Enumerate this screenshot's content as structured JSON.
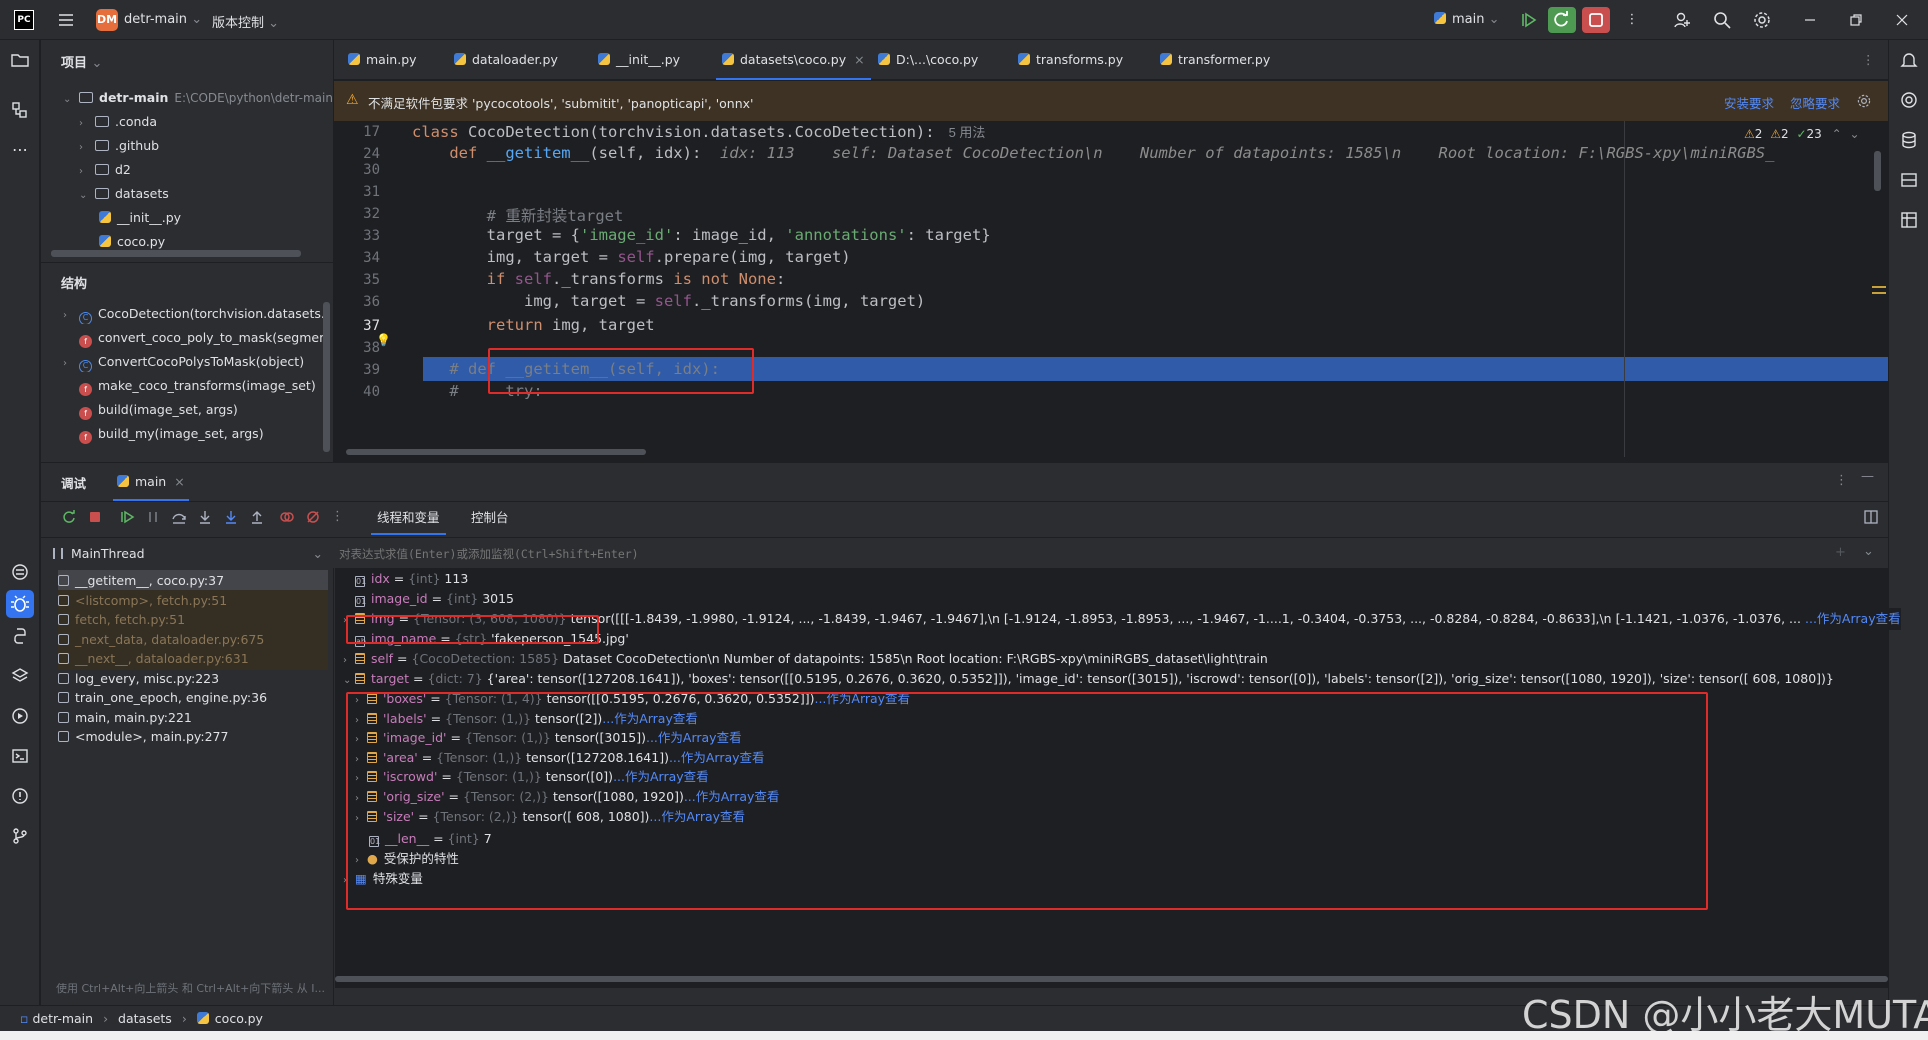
{
  "titlebar": {
    "logo": "PC",
    "project_badge": "DM",
    "project_name": "detr-main",
    "vcs_label": "版本控制",
    "run_config": "main"
  },
  "project_panel": {
    "title": "项目",
    "root_name": "detr-main",
    "root_path": "E:\\CODE\\python\\detr-main",
    "items": [
      ".conda",
      ".github",
      "d2",
      "datasets",
      "__init__.py",
      "coco.py"
    ]
  },
  "structure_panel": {
    "title": "结构",
    "items": [
      "CocoDetection(torchvision.datasets.CocoDetection)",
      "convert_coco_poly_to_mask(segmentations, height, width)",
      "ConvertCocoPolysToMask(object)",
      "make_coco_transforms(image_set)",
      "build(image_set, args)",
      "build_my(image_set, args)"
    ]
  },
  "tabs": [
    "main.py",
    "dataloader.py",
    "__init__.py",
    "datasets\\coco.py",
    "D:\\...\\coco.py",
    "transforms.py",
    "transformer.py"
  ],
  "warning": {
    "text": "不满足软件包要求 'pycocotools', 'submitit', 'panopticapi', 'onnx'",
    "install": "安装要求",
    "ignore": "忽略要求"
  },
  "inspections": {
    "warnings": "2",
    "weak": "2",
    "ok": "23"
  },
  "editor": {
    "lines": [
      {
        "num": "17",
        "parts": [
          [
            "kw",
            "class "
          ],
          [
            "",
            "CocoDetection(torchvision.datasets.CocoDetection):"
          ]
        ],
        "hint": "5 用法"
      },
      {
        "num": "24",
        "parts": [
          [
            "",
            "    "
          ],
          [
            "kw",
            "def "
          ],
          [
            "fn",
            "__getitem__"
          ],
          [
            "",
            "(self, idx):"
          ]
        ],
        "inlay": "  idx: 113    self: Dataset CocoDetection\\n    Number of datapoints: 1585\\n    Root location: F:\\RGBS-xpy\\miniRGBS_"
      },
      {
        "num": "30",
        "parts": []
      },
      {
        "num": "31",
        "parts": []
      },
      {
        "num": "32",
        "parts": [
          [
            "cm",
            "        # 重新封装target"
          ]
        ]
      },
      {
        "num": "33",
        "parts": [
          [
            "",
            "        target = {"
          ],
          [
            "str",
            "'image_id'"
          ],
          [
            "",
            ": image_id, "
          ],
          [
            "str",
            "'annotations'"
          ],
          [
            "",
            ": target}"
          ]
        ]
      },
      {
        "num": "34",
        "parts": [
          [
            "",
            "        img, target = "
          ],
          [
            "self",
            "self"
          ],
          [
            "",
            ".prepare(img, target)"
          ]
        ]
      },
      {
        "num": "35",
        "parts": [
          [
            "",
            "        "
          ],
          [
            "kw",
            "if "
          ],
          [
            "self",
            "self"
          ],
          [
            "",
            "._transforms "
          ],
          [
            "kw",
            "is not None"
          ],
          [
            "",
            ":"
          ]
        ]
      },
      {
        "num": "36",
        "parts": [
          [
            "",
            "            img, target = "
          ],
          [
            "self",
            "self"
          ],
          [
            "",
            "._transforms(img, target)"
          ]
        ]
      },
      {
        "num": "37",
        "parts": [
          [
            "",
            "        "
          ],
          [
            "kw",
            "return "
          ],
          [
            "",
            "img, target"
          ]
        ]
      },
      {
        "num": "38",
        "parts": []
      },
      {
        "num": "39",
        "parts": [
          [
            "cm",
            "    # def __getitem__(self, idx):"
          ]
        ]
      },
      {
        "num": "40",
        "parts": [
          [
            "cm",
            "    #     try:"
          ]
        ]
      }
    ]
  },
  "debug": {
    "tab_debug": "调试",
    "tab_main": "main",
    "tab_threads": "线程和变量",
    "tab_console": "控制台",
    "thread": "MainThread",
    "eval_placeholder": "对表达式求值(Enter)或添加监视(Ctrl+Shift+Enter)",
    "frames": [
      {
        "text": "__getitem__, coco.py:37",
        "kind": "sel"
      },
      {
        "text": "<listcomp>, fetch.py:51",
        "kind": "lib"
      },
      {
        "text": "fetch, fetch.py:51",
        "kind": "lib"
      },
      {
        "text": "_next_data, dataloader.py:675",
        "kind": "lib"
      },
      {
        "text": "__next__, dataloader.py:631",
        "kind": "lib"
      },
      {
        "text": "log_every, misc.py:223",
        "kind": ""
      },
      {
        "text": "train_one_epoch, engine.py:36",
        "kind": ""
      },
      {
        "text": "main, main.py:221",
        "kind": ""
      },
      {
        "text": "<module>, main.py:277",
        "kind": ""
      }
    ],
    "footer_hint": "使用 Ctrl+Alt+向上箭头 和 Ctrl+Alt+向下箭头 从 I...",
    "vars": {
      "idx": {
        "name": "idx",
        "type": "{int} ",
        "value": "113"
      },
      "image_id": {
        "name": "image_id",
        "type": "{int} ",
        "value": "3015"
      },
      "img": {
        "name": "img",
        "type": "{Tensor: (3, 608, 1080)} ",
        "value": "tensor([[[-1.8439, -1.9980, -1.9124,  ..., -1.8439, -1.9467, -1.9467],\\n         [-1.9124, -1.8953, -1.8953,  ..., -1.9467, -1....1, -0.3404, -0.3753,  ..., -0.8284, -0.8284, -0.8633],\\n         [-1.1421, -1.0376, -1.0376,  ..., -1.2816, -",
        "link": "...作为Array查看"
      },
      "img_name": {
        "name": "img_name",
        "type": "{str} ",
        "value": "'fakeperson_1545.jpg'"
      },
      "self": {
        "name": "self",
        "type": "{CocoDetection: 1585} ",
        "value": "Dataset CocoDetection\\n    Number of datapoints: 1585\\n    Root location: F:\\RGBS-xpy\\miniRGBS_dataset\\light\\train"
      },
      "target": {
        "name": "target",
        "type": "{dict: 7} ",
        "value": "{'area': tensor([127208.1641]), 'boxes': tensor([[0.5195, 0.2676, 0.3620, 0.5352]]), 'image_id': tensor([3015]), 'iscrowd': tensor([0]), 'labels': tensor([2]), 'orig_size': tensor([1080, 1920]), 'size': tensor([ 608, 1080])}"
      },
      "children": [
        {
          "name": "'boxes'",
          "type": "{Tensor: (1, 4)} ",
          "value": "tensor([[0.5195, 0.2676, 0.3620, 0.5352]])",
          "link": "...作为Array查看"
        },
        {
          "name": "'labels'",
          "type": "{Tensor: (1,)} ",
          "value": "tensor([2])",
          "link": "...作为Array查看"
        },
        {
          "name": "'image_id'",
          "type": "{Tensor: (1,)} ",
          "value": "tensor([3015])",
          "link": "...作为Array查看"
        },
        {
          "name": "'area'",
          "type": "{Tensor: (1,)} ",
          "value": "tensor([127208.1641])",
          "link": "...作为Array查看"
        },
        {
          "name": "'iscrowd'",
          "type": "{Tensor: (1,)} ",
          "value": "tensor([0])",
          "link": "...作为Array查看"
        },
        {
          "name": "'orig_size'",
          "type": "{Tensor: (2,)} ",
          "value": "tensor([1080, 1920])",
          "link": "...作为Array查看"
        },
        {
          "name": "'size'",
          "type": "{Tensor: (2,)} ",
          "value": "tensor([ 608, 1080])",
          "link": "...作为Array查看"
        }
      ],
      "len": {
        "name": "__len__",
        "type": "{int} ",
        "value": "7"
      },
      "protected": "受保护的特性",
      "special": "特殊变量"
    }
  },
  "statusbar": {
    "crumbs": [
      "detr-main",
      "datasets",
      "coco.py"
    ],
    "watermark": "CSDN @小小老大MUTA"
  },
  "colors": {
    "accent": "#3574f0",
    "highlight_line": "#2f5ba8",
    "annotation_red": "#e02b2b"
  }
}
